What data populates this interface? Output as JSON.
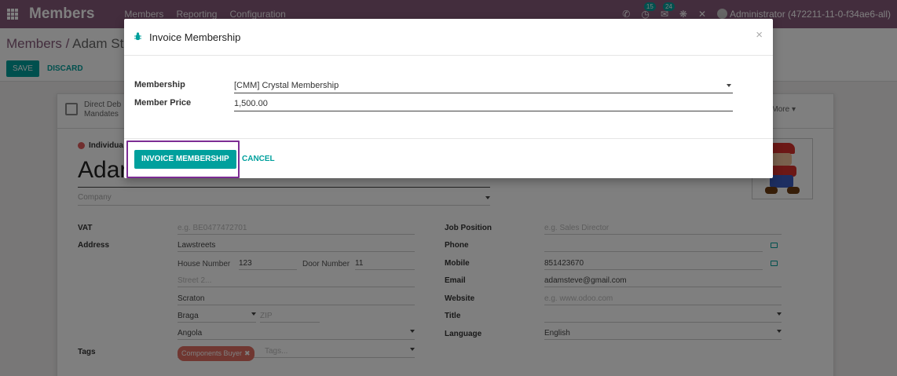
{
  "navbar": {
    "brand": "Members",
    "menus": [
      "Members",
      "Reporting",
      "Configuration"
    ],
    "badge_activity": "15",
    "badge_discuss": "24",
    "user": "Administrator (472211-11-0-f34ae6-all)",
    "bg_color": "#875a7b"
  },
  "breadcrumb": {
    "parent": "Members",
    "separator": "/",
    "current": "Adam Ste"
  },
  "control": {
    "save_label": "SAVE",
    "discard_label": "DISCARD"
  },
  "sheet": {
    "stat_button": {
      "line1": "Direct Deb",
      "line2": "Mandates"
    },
    "more_label": "More",
    "partner_type": "Individua",
    "name": "Adar",
    "company_placeholder": "Company",
    "left_fields": {
      "vat_label": "VAT",
      "vat_placeholder": "e.g. BE0477472701",
      "address_label": "Address",
      "street": "Lawstreets",
      "house_number_label": "House Number",
      "house_number": "123",
      "door_number_label": "Door Number",
      "door_number": "11",
      "street2_placeholder": "Street 2...",
      "city": "Scraton",
      "state": "Braga",
      "zip_placeholder": "ZIP",
      "country": "Angola",
      "tags_label": "Tags",
      "tag": "Components Buyer",
      "tags_placeholder": "Tags..."
    },
    "right_fields": {
      "job_label": "Job Position",
      "job_placeholder": "e.g. Sales Director",
      "phone_label": "Phone",
      "phone": "",
      "mobile_label": "Mobile",
      "mobile": "851423670",
      "email_label": "Email",
      "email": "adamsteve@gmail.com",
      "website_label": "Website",
      "website_placeholder": "e.g. www.odoo.com",
      "title_label": "Title",
      "language_label": "Language",
      "language": "English"
    }
  },
  "modal": {
    "title": "Invoice Membership",
    "close": "×",
    "membership_label": "Membership",
    "membership_value": "[CMM] Crystal Membership",
    "price_label": "Member Price",
    "price_value": "1,500.00",
    "invoice_button": "INVOICE MEMBERSHIP",
    "cancel_button": "CANCEL",
    "accent_color": "#00a09d",
    "highlight_color": "#7c2d94"
  }
}
